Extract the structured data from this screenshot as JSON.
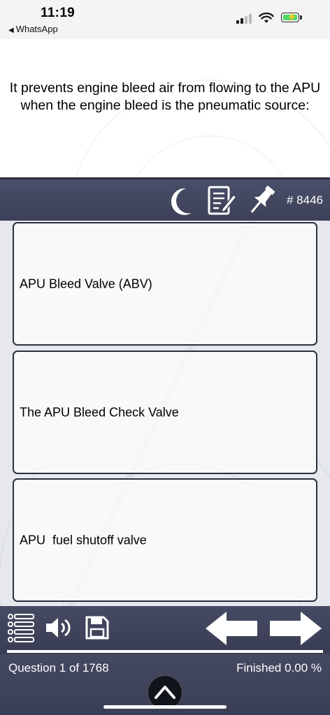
{
  "status_bar": {
    "time": "11:19",
    "back_app": "WhatsApp",
    "battery_color": "#4cd964"
  },
  "question": {
    "text": "It prevents engine bleed air from flowing to the APU when the engine bleed is the pneumatic source:"
  },
  "toolbar": {
    "icons": [
      "moon-icon",
      "notes-icon",
      "pin-icon"
    ],
    "question_id": "# 8446"
  },
  "answers": [
    {
      "label": "APU Bleed Valve (ABV)"
    },
    {
      "label": "The APU Bleed Check Valve"
    },
    {
      "label": "APU  fuel shutoff valve"
    }
  ],
  "bottom_toolbar": {
    "icons": [
      "list-icon",
      "speaker-icon",
      "save-icon",
      "arrow-left-icon",
      "arrow-right-icon"
    ]
  },
  "footer": {
    "question_counter": "Question 1 of 1768",
    "finished": "Finished 0.00 %",
    "finished_percent": 0.0
  },
  "colors": {
    "toolbar": "#42465e",
    "answer_border": "#2c2f3c"
  }
}
